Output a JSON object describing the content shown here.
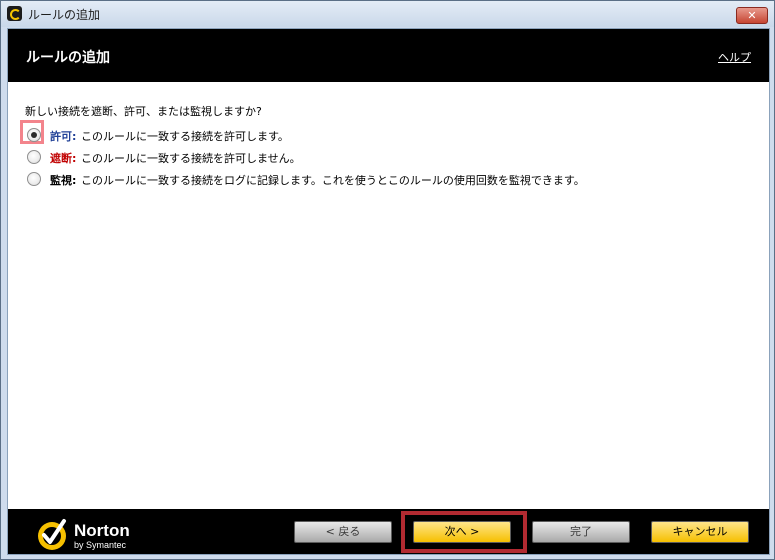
{
  "window": {
    "title": "ルールの追加",
    "close_label": "✕"
  },
  "header": {
    "title": "ルールの追加",
    "help_link": "ヘルプ"
  },
  "question": "新しい接続を遮断、許可、または監視しますか?",
  "options": [
    {
      "label": "許可:",
      "description": "このルールに一致する接続を許可します。",
      "selected": true,
      "label_color": "#1f3f96"
    },
    {
      "label": "遮断:",
      "description": "このルールに一致する接続を許可しません。",
      "selected": false,
      "label_color": "#c00000"
    },
    {
      "label": "監視:",
      "description": "このルールに一致する接続をログに記録します。これを使うとこのルールの使用回数を監視できます。",
      "selected": false,
      "label_color": "#000000"
    }
  ],
  "footer": {
    "brand": "Norton",
    "brand_sub": "by Symantec",
    "back_button": "< 戻る",
    "next_button": "次へ >",
    "finish_button": "完了",
    "cancel_button": "キャンセル"
  },
  "colors": {
    "header_bg": "#000000",
    "accent_yellow": "#f6c000",
    "highlight_red": "#b22a31",
    "highlight_pink": "#f3848c"
  }
}
